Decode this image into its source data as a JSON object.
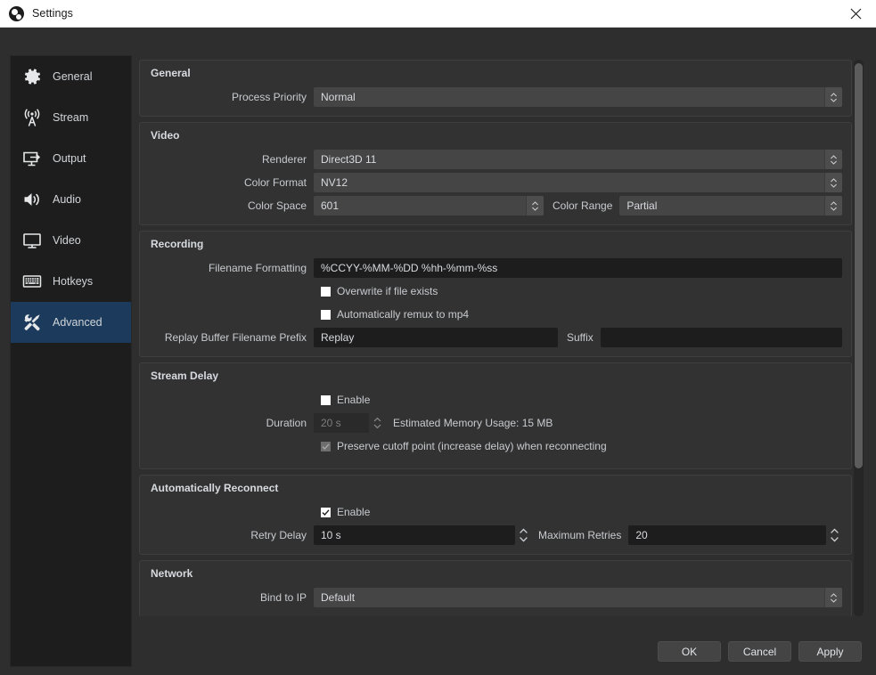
{
  "window": {
    "title": "Settings",
    "logo_icon": "obs-logo-icon",
    "close_icon": "close-icon"
  },
  "sidebar": {
    "items": [
      {
        "label": "General",
        "icon": "gear-icon",
        "selected": false
      },
      {
        "label": "Stream",
        "icon": "broadcast-icon",
        "selected": false
      },
      {
        "label": "Output",
        "icon": "output-icon",
        "selected": false
      },
      {
        "label": "Audio",
        "icon": "speaker-icon",
        "selected": false
      },
      {
        "label": "Video",
        "icon": "monitor-icon",
        "selected": false
      },
      {
        "label": "Hotkeys",
        "icon": "keyboard-icon",
        "selected": false
      },
      {
        "label": "Advanced",
        "icon": "tools-icon",
        "selected": true
      }
    ]
  },
  "groups": {
    "general": {
      "title": "General",
      "process_priority_label": "Process Priority",
      "process_priority_value": "Normal"
    },
    "video": {
      "title": "Video",
      "renderer_label": "Renderer",
      "renderer_value": "Direct3D 11",
      "color_format_label": "Color Format",
      "color_format_value": "NV12",
      "color_space_label": "Color Space",
      "color_space_value": "601",
      "color_range_label": "Color Range",
      "color_range_value": "Partial"
    },
    "recording": {
      "title": "Recording",
      "filename_formatting_label": "Filename Formatting",
      "filename_formatting_value": "%CCYY-%MM-%DD %hh-%mm-%ss",
      "overwrite_label": "Overwrite if file exists",
      "overwrite_checked": false,
      "remux_label": "Automatically remux to mp4",
      "remux_checked": false,
      "replay_prefix_label": "Replay Buffer Filename Prefix",
      "replay_prefix_value": "Replay",
      "suffix_label": "Suffix",
      "suffix_value": ""
    },
    "stream_delay": {
      "title": "Stream Delay",
      "enable_label": "Enable",
      "enable_checked": false,
      "duration_label": "Duration",
      "duration_value": "20 s",
      "memory_usage_text": "Estimated Memory Usage: 15 MB",
      "preserve_label": "Preserve cutoff point (increase delay) when reconnecting",
      "preserve_checked": true
    },
    "auto_reconnect": {
      "title": "Automatically Reconnect",
      "enable_label": "Enable",
      "enable_checked": true,
      "retry_delay_label": "Retry Delay",
      "retry_delay_value": "10 s",
      "max_retries_label": "Maximum Retries",
      "max_retries_value": "20"
    },
    "network": {
      "title": "Network",
      "bind_ip_label": "Bind to IP",
      "bind_ip_value": "Default"
    }
  },
  "footer": {
    "ok": "OK",
    "cancel": "Cancel",
    "apply": "Apply"
  },
  "colors": {
    "selection": "#1b3a5c",
    "window_bg": "#2e2e2e",
    "group_bg": "#323232",
    "field_dark": "#1d1d1d",
    "combo_bg": "#454545"
  }
}
